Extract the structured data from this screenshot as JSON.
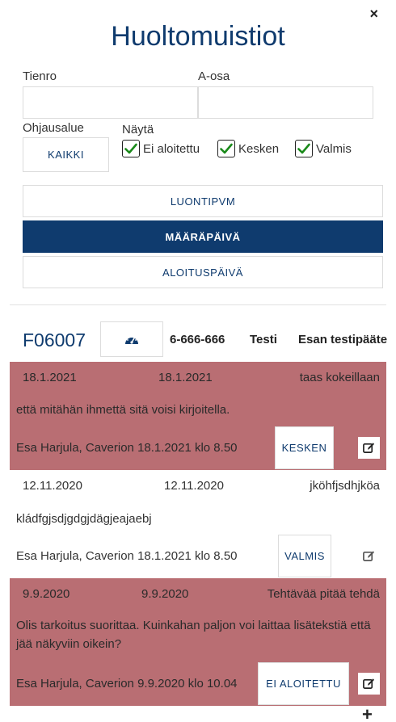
{
  "dialog": {
    "close_label": "×",
    "title": "Huoltomuistiot"
  },
  "filters": {
    "tienro_label": "Tienro",
    "tienro_value": "",
    "aosa_label": "A-osa",
    "aosa_value": "",
    "ohjausalue_label": "Ohjausalue",
    "ohjausalue_button": "KAIKKI",
    "nayta_label": "Näytä",
    "checkboxes": [
      {
        "label": "Ei aloitettu",
        "checked": true
      },
      {
        "label": "Kesken",
        "checked": true
      },
      {
        "label": "Valmis",
        "checked": true
      }
    ]
  },
  "sort": {
    "buttons": [
      {
        "label": "LUONTIPVM",
        "active": false
      },
      {
        "label": "MÄÄRÄPÄIVÄ",
        "active": true
      },
      {
        "label": "ALOITUSPÄIVÄ",
        "active": false
      }
    ]
  },
  "device": {
    "id": "F06007",
    "icon": "dashboard-icon",
    "number": "6-666-666",
    "name": "Testi",
    "location": "Esan testipääte"
  },
  "notes": [
    {
      "date1": "18.1.2021",
      "date2": "18.1.2021",
      "title": "taas kokeillaan",
      "body": "että mitähän ihmettä sitä voisi kirjoitella.",
      "meta": "Esa Harjula, Caverion 18.1.2021 klo 8.50",
      "status": "KESKEN",
      "highlight": true
    },
    {
      "date1": "12.11.2020",
      "date2": "12.11.2020",
      "title": "jköhfjsdhjköa",
      "body": "kládfgjsdjgdgjdägjeajaebj",
      "meta": "Esa Harjula, Caverion 18.1.2021 klo 8.50",
      "status": "VALMIS",
      "highlight": false
    },
    {
      "date1": "9.9.2020",
      "date2": "9.9.2020",
      "title": "Tehtävää pitää tehdä",
      "body": "Olis tarkoitus suorittaa. Kuinkahan paljon voi laittaa lisätekstiä että jää näkyviin oikein?",
      "meta": "Esa Harjula, Caverion 9.9.2020 klo 10.04",
      "status": "EI ALOITETTU",
      "highlight": true
    }
  ],
  "add_label": "+",
  "colors": {
    "primary": "#0f3b6e",
    "highlight_row": "#b96e73",
    "check": "#1a8a1a"
  }
}
